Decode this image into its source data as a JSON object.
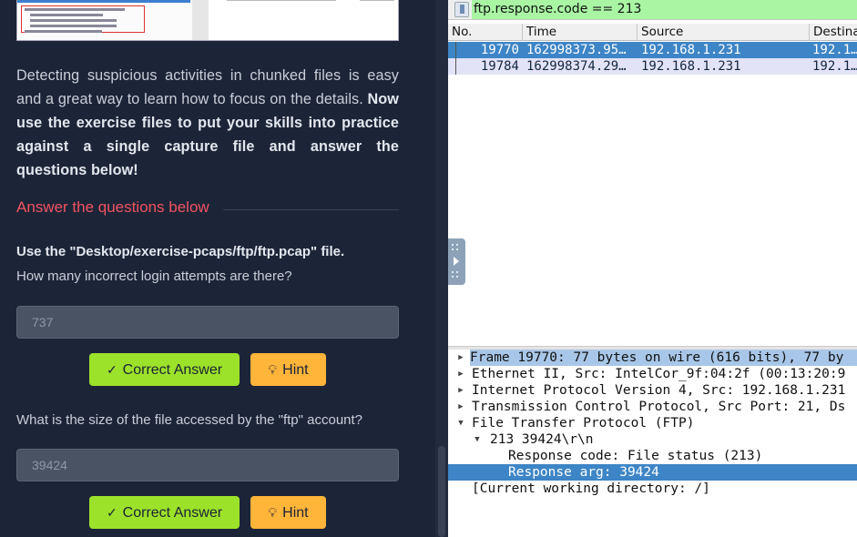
{
  "left_panel": {
    "paragraph_normal": "Detecting suspicious activities in chunked files is easy and a great way to learn how to focus on the details. ",
    "paragraph_bold": "Now use the exercise files to put your skills into practice against a single capture file and answer the questions below!",
    "section_heading": "Answer the questions below",
    "question_1": {
      "instruction": "Use the \"Desktop/exercise-pcaps/ftp/ftp.pcap\" file.",
      "text": "How many incorrect login attempts are there?",
      "answer": "737",
      "correct_label": "Correct Answer",
      "hint_label": "Hint"
    },
    "question_2": {
      "text": "What is the size of the file accessed by the \"ftp\" account?",
      "answer": "39424",
      "correct_label": "Correct Answer",
      "hint_label": "Hint"
    },
    "colors": {
      "heading": "#f2525f",
      "correct_button": "#9ce22a",
      "hint_button": "#ffb43a"
    },
    "icons": {
      "check": "check-icon",
      "hint": "lightbulb-icon"
    }
  },
  "wireshark": {
    "display_filter": "ftp.response.code == 213",
    "columns": [
      "No.",
      "Time",
      "Source",
      "Destina"
    ],
    "packets": [
      {
        "no": "19770",
        "time": "162998373.95…",
        "source": "192.168.1.231",
        "destination": "192.1…",
        "selected": true
      },
      {
        "no": "19784",
        "time": "162998374.29…",
        "source": "192.168.1.231",
        "destination": "192.1…",
        "selected": false
      }
    ],
    "details": [
      {
        "text": "Frame 19770: 77 bytes on wire (616 bits), 77 by",
        "state": "collapsed"
      },
      {
        "text": "Ethernet II, Src: IntelCor_9f:04:2f (00:13:20:9",
        "state": "collapsed"
      },
      {
        "text": "Internet Protocol Version 4, Src: 192.168.1.231",
        "state": "collapsed"
      },
      {
        "text": "Transmission Control Protocol, Src Port: 21, Ds",
        "state": "collapsed"
      },
      {
        "text": "File Transfer Protocol (FTP)",
        "state": "expanded"
      },
      {
        "text": "213 39424\\r\\n",
        "state": "expanded"
      },
      {
        "text": "Response code: File status (213)",
        "state": "leaf"
      },
      {
        "text": "Response arg: 39424",
        "state": "leaf-selected"
      },
      {
        "text": "[Current working directory: /]",
        "state": "leaf"
      }
    ],
    "colors": {
      "filter_ok": "#a9f5a3",
      "selection": "#3d85c6",
      "row_alt": "#e3e3f8"
    }
  }
}
